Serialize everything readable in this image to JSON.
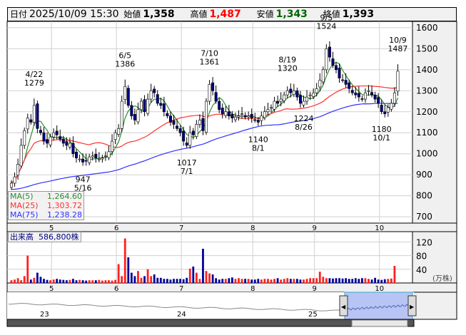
{
  "header": {
    "date_label": "日付",
    "date": "2025/10/09 15:30",
    "open_label": "始値",
    "open": "1,358",
    "high_label": "高値",
    "high": "1,487",
    "low_label": "安値",
    "low": "1,343",
    "close_label": "終値",
    "close": "1,393"
  },
  "legend": {
    "ma5_label": "MA(5)",
    "ma5": "1,264.60",
    "ma25_label": "MA(25)",
    "ma25": "1,303.72",
    "ma75_label": "MA(75)",
    "ma75": "1,238.28"
  },
  "volume_legend": {
    "label": "出来高",
    "value": "586,800株"
  },
  "colors": {
    "ma5": "#2e8b2e",
    "ma25": "#ff3030",
    "ma75": "#3030ff",
    "up_vol": "#ff2020",
    "down_vol": "#000099",
    "candle_down": "#000080"
  },
  "chart_data": {
    "type": "candlestick",
    "price_axis": {
      "ticks": [
        700,
        800,
        900,
        1000,
        1100,
        1200,
        1300,
        1400,
        1500,
        1600
      ],
      "range": [
        670,
        1630
      ]
    },
    "volume_axis": {
      "ticks": [
        40,
        80,
        120
      ],
      "unit": "(万株)",
      "range": [
        0,
        150
      ]
    },
    "month_ticks": [
      {
        "label": "5",
        "index": 13
      },
      {
        "label": "6",
        "index": 33
      },
      {
        "label": "7",
        "index": 53
      },
      {
        "label": "8",
        "index": 75
      },
      {
        "label": "9",
        "index": 94
      },
      {
        "label": "10",
        "index": 114
      }
    ],
    "closes": [
      860,
      890,
      950,
      1040,
      1110,
      1170,
      1150,
      1230,
      1120,
      1100,
      1060,
      1050,
      1080,
      1100,
      1090,
      1070,
      1050,
      1040,
      1050,
      1000,
      980,
      975,
      960,
      965,
      985,
      990,
      980,
      975,
      980,
      990,
      1010,
      1060,
      1100,
      1120,
      1250,
      1320,
      1230,
      1180,
      1160,
      1210,
      1250,
      1200,
      1260,
      1300,
      1290,
      1240,
      1230,
      1200,
      1180,
      1150,
      1140,
      1120,
      1100,
      1060,
      1040,
      1100,
      1090,
      1140,
      1160,
      1110,
      1250,
      1330,
      1300,
      1250,
      1210,
      1190,
      1200,
      1180,
      1170,
      1175,
      1180,
      1190,
      1175,
      1180,
      1170,
      1160,
      1150,
      1180,
      1200,
      1210,
      1220,
      1250,
      1240,
      1260,
      1280,
      1300,
      1290,
      1300,
      1270,
      1240,
      1250,
      1270,
      1280,
      1290,
      1310,
      1350,
      1400,
      1500,
      1460,
      1420,
      1400,
      1360,
      1350,
      1330,
      1310,
      1290,
      1280,
      1270,
      1260,
      1290,
      1300,
      1280,
      1260,
      1240,
      1200,
      1190,
      1220,
      1240,
      1290,
      1393
    ],
    "volumes": [
      8,
      10,
      14,
      8,
      20,
      80,
      10,
      15,
      30,
      18,
      12,
      9,
      8,
      10,
      12,
      10,
      9,
      8,
      9,
      12,
      8,
      9,
      8,
      7,
      8,
      8,
      8,
      9,
      7,
      8,
      8,
      7,
      9,
      55,
      20,
      130,
      75,
      30,
      20,
      35,
      15,
      20,
      40,
      20,
      25,
      15,
      15,
      12,
      12,
      10,
      12,
      12,
      12,
      11,
      15,
      42,
      48,
      30,
      12,
      100,
      35,
      28,
      25,
      14,
      10,
      12,
      12,
      14,
      16,
      12,
      14,
      12,
      12,
      12,
      10,
      10,
      12,
      10,
      12,
      12,
      10,
      12,
      14,
      10,
      12,
      14,
      12,
      12,
      12,
      10,
      10,
      12,
      14,
      14,
      14,
      33,
      18,
      14,
      14,
      13,
      14,
      14,
      13,
      14,
      12,
      12,
      14,
      12,
      14,
      14,
      12,
      10,
      15,
      10,
      9,
      11,
      12,
      13,
      50
    ],
    "annotations": [
      {
        "label": "4/22",
        "value": "1279",
        "index": 7,
        "pos": "above"
      },
      {
        "label": "947",
        "value": "5/16",
        "index": 22,
        "pos": "below"
      },
      {
        "label": "6/5",
        "value": "1386",
        "index": 35,
        "pos": "above"
      },
      {
        "label": "1017",
        "value": "7/1",
        "index": 54,
        "pos": "below"
      },
      {
        "label": "7/10",
        "value": "1361",
        "index": 61,
        "pos": "above"
      },
      {
        "label": "1140",
        "value": "8/1",
        "index": 76,
        "pos": "below"
      },
      {
        "label": "8/19",
        "value": "1320",
        "index": 85,
        "pos": "above"
      },
      {
        "label": "1224",
        "value": "8/26",
        "index": 90,
        "pos": "below"
      },
      {
        "label": "9/5",
        "value": "1524",
        "index": 97,
        "pos": "above"
      },
      {
        "label": "1180",
        "value": "10/1",
        "index": 114,
        "pos": "below"
      },
      {
        "label": "10/9",
        "value": "1487",
        "index": 119,
        "pos": "above"
      }
    ],
    "navigator": {
      "year_labels": [
        "23",
        "24",
        "25"
      ]
    }
  }
}
